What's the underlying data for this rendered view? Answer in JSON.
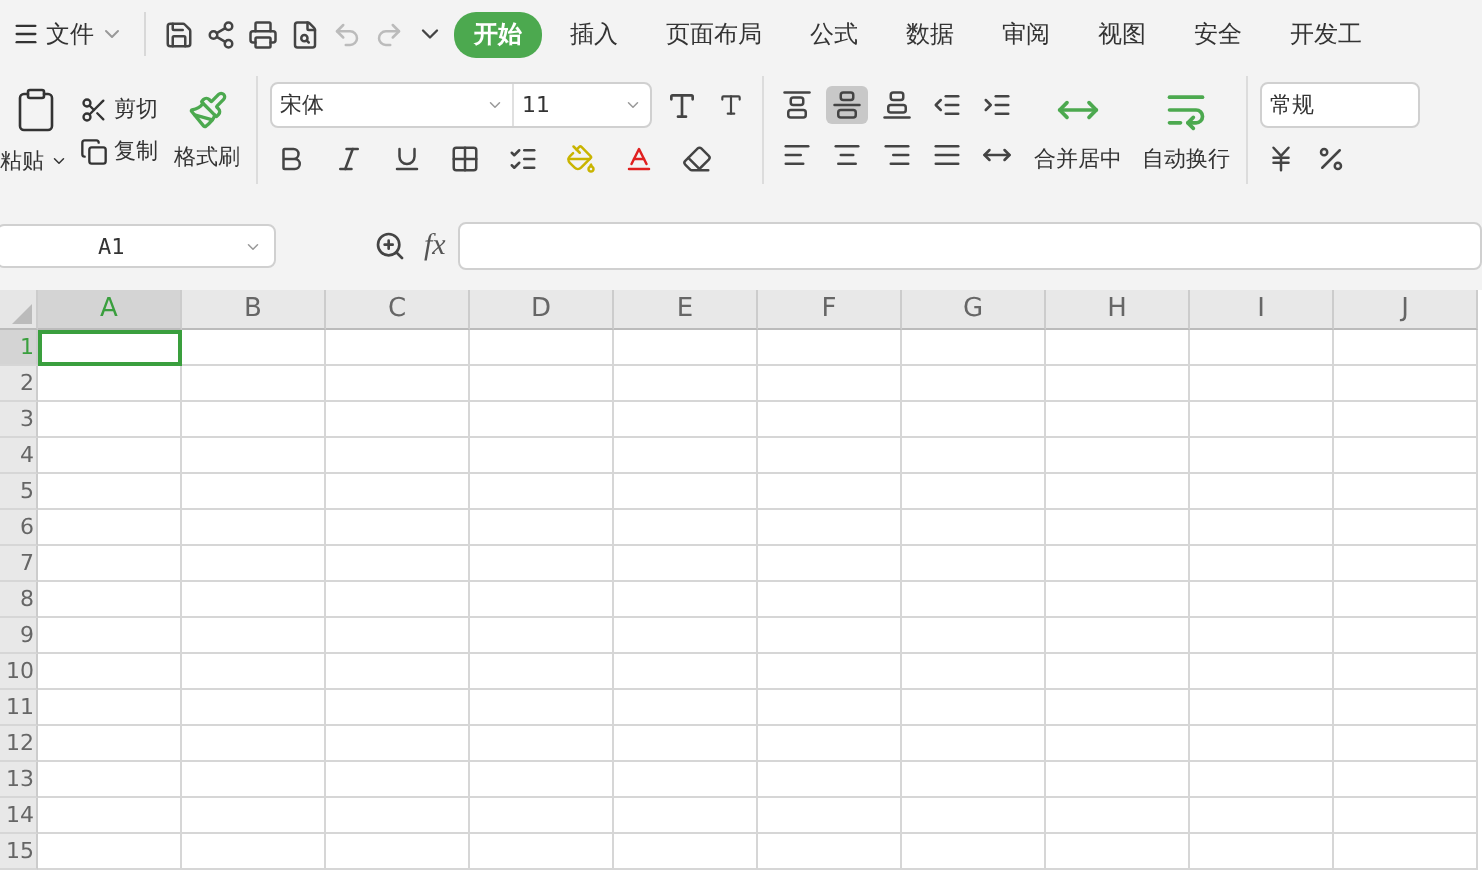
{
  "menu": {
    "label": "文件"
  },
  "tabs": [
    {
      "label": "开始",
      "selected": true
    },
    {
      "label": "插入",
      "selected": false
    },
    {
      "label": "页面布局",
      "selected": false
    },
    {
      "label": "公式",
      "selected": false
    },
    {
      "label": "数据",
      "selected": false
    },
    {
      "label": "审阅",
      "selected": false
    },
    {
      "label": "视图",
      "selected": false
    },
    {
      "label": "安全",
      "selected": false
    },
    {
      "label": "开发工",
      "selected": false
    }
  ],
  "clipboard": {
    "paste": "粘贴",
    "cut": "剪切",
    "copy": "复制",
    "format_painter": "格式刷"
  },
  "font": {
    "name": "宋体",
    "size": "11"
  },
  "alignment": {
    "top_row": [
      {
        "kind": "top",
        "selected": false
      },
      {
        "kind": "middle",
        "selected": true
      },
      {
        "kind": "bottom",
        "selected": false
      },
      {
        "kind": "outdent",
        "selected": false
      },
      {
        "kind": "indent",
        "selected": false
      }
    ],
    "bottom_row": [
      {
        "kind": "left",
        "selected": false
      },
      {
        "kind": "center",
        "selected": false
      },
      {
        "kind": "right",
        "selected": false
      },
      {
        "kind": "justify",
        "selected": false
      },
      {
        "kind": "distributed",
        "selected": false
      }
    ],
    "merge": "合并居中",
    "wrap": "自动换行"
  },
  "number_format": {
    "value": "常规"
  },
  "formula_bar": {
    "name_box": "A1",
    "fx": "fx"
  },
  "columns": [
    {
      "label": "A",
      "selected": true
    },
    {
      "label": "B",
      "selected": false
    },
    {
      "label": "C",
      "selected": false
    },
    {
      "label": "D",
      "selected": false
    },
    {
      "label": "E",
      "selected": false
    },
    {
      "label": "F",
      "selected": false
    },
    {
      "label": "G",
      "selected": false
    },
    {
      "label": "H",
      "selected": false
    },
    {
      "label": "I",
      "selected": false
    },
    {
      "label": "J",
      "selected": false
    }
  ],
  "rows": [
    {
      "label": "1",
      "selected": true
    },
    {
      "label": "2",
      "selected": false
    },
    {
      "label": "3",
      "selected": false
    },
    {
      "label": "4",
      "selected": false
    },
    {
      "label": "5",
      "selected": false
    },
    {
      "label": "6",
      "selected": false
    },
    {
      "label": "7",
      "selected": false
    },
    {
      "label": "8",
      "selected": false
    },
    {
      "label": "9",
      "selected": false
    },
    {
      "label": "10",
      "selected": false
    },
    {
      "label": "11",
      "selected": false
    },
    {
      "label": "12",
      "selected": false
    },
    {
      "label": "13",
      "selected": false
    },
    {
      "label": "14",
      "selected": false
    },
    {
      "label": "15",
      "selected": false
    }
  ]
}
